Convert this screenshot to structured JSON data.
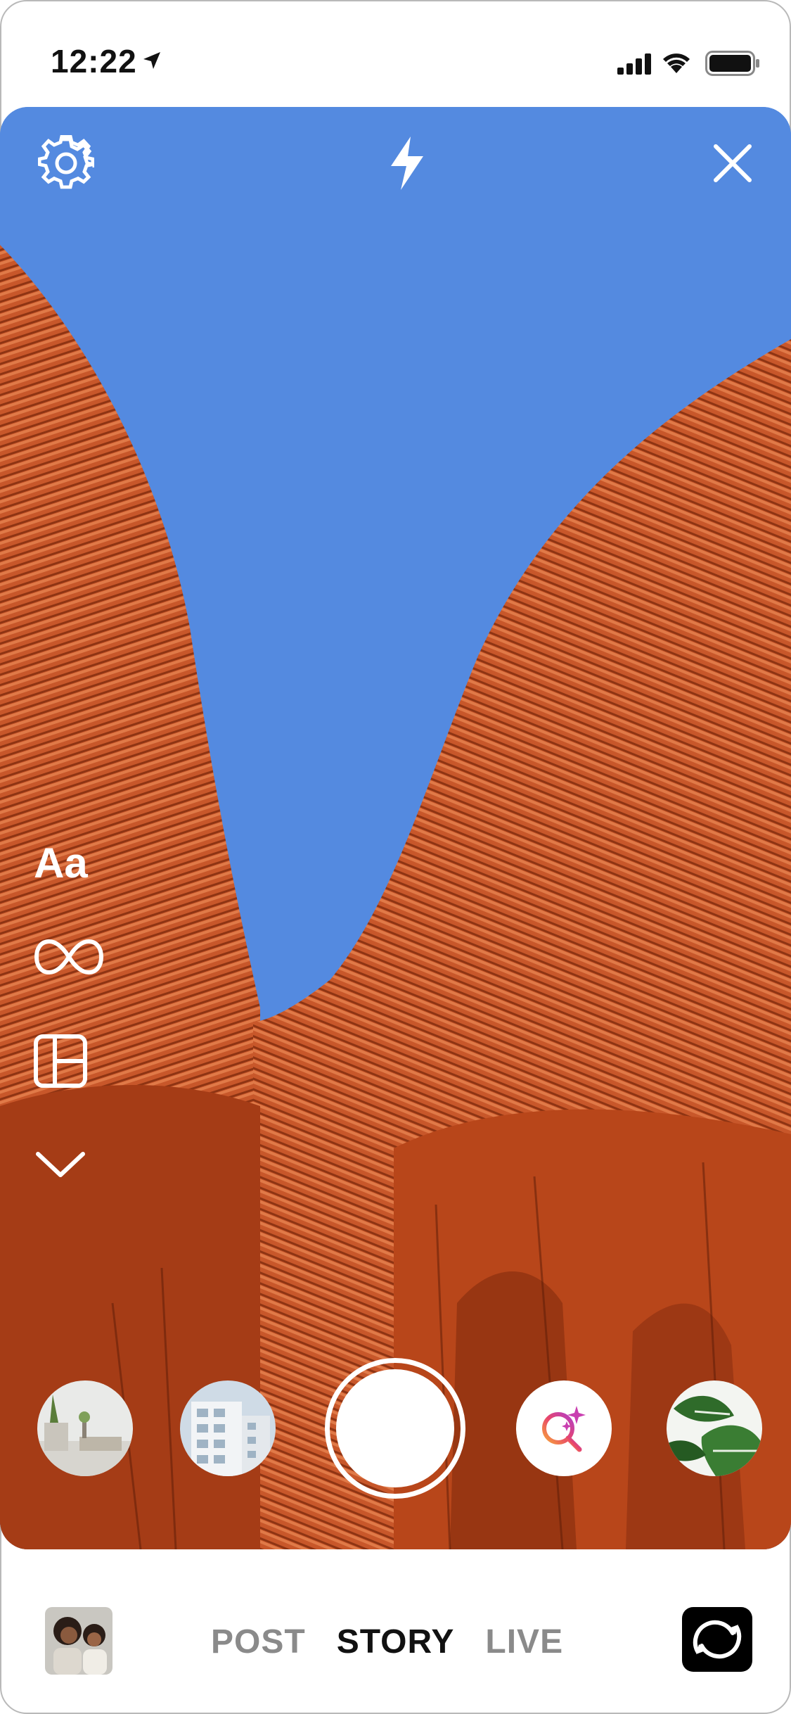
{
  "status_bar": {
    "time": "12:22",
    "icons": [
      "location-arrow-icon",
      "cellular-signal-icon",
      "wifi-icon",
      "battery-icon"
    ]
  },
  "camera": {
    "top_controls": [
      "gear-icon",
      "flash-icon",
      "close-icon"
    ],
    "side_tools": {
      "text_label": "Aa",
      "icons": [
        "text-tool",
        "boomerang-infinity-icon",
        "layout-grid-icon",
        "chevron-down-icon"
      ]
    },
    "bottom_controls": {
      "thumbnails": [
        "gallery-thumb-livingroom",
        "gallery-thumb-building",
        "gallery-thumb-plant"
      ],
      "shutter": "shutter-button",
      "effects": "search-effects-icon"
    },
    "colors": {
      "sky": "#548ae0",
      "facade": "#c8572a",
      "facade_shadow": "#9a3615"
    }
  },
  "bottom_bar": {
    "modes": [
      {
        "label": "POST",
        "active": false
      },
      {
        "label": "STORY",
        "active": true
      },
      {
        "label": "LIVE",
        "active": false
      }
    ],
    "icons": [
      "gallery-thumbnail",
      "flip-camera-icon"
    ]
  }
}
